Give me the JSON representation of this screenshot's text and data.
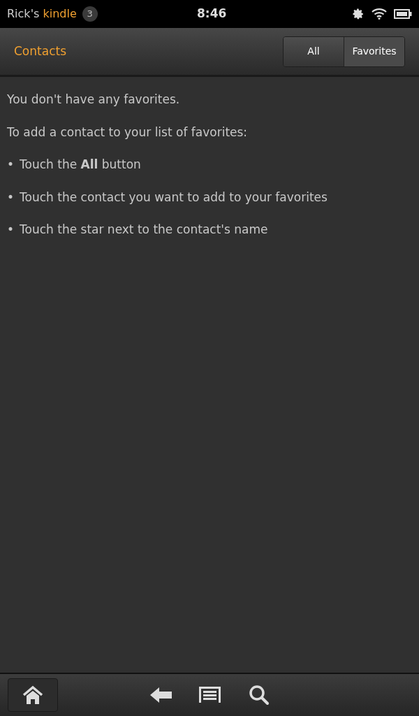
{
  "status_bar": {
    "owner": "Rick's",
    "device": "kindle",
    "notification_count": "3",
    "time": "8:46"
  },
  "header": {
    "title": "Contacts",
    "tabs": [
      {
        "label": "All",
        "selected": false
      },
      {
        "label": "Favorites",
        "selected": true
      }
    ]
  },
  "content": {
    "message": "You don't have any favorites.",
    "intro": "To add a contact to your list of favorites:",
    "steps": [
      {
        "bullet": "•",
        "text": "Touch the **All** button"
      },
      {
        "bullet": "•",
        "text": "Touch the contact you want to add to your favorites"
      },
      {
        "bullet": "•",
        "text": "Touch the star next to the contact's name"
      }
    ]
  },
  "nav_bar": {
    "home_selected": true
  }
}
